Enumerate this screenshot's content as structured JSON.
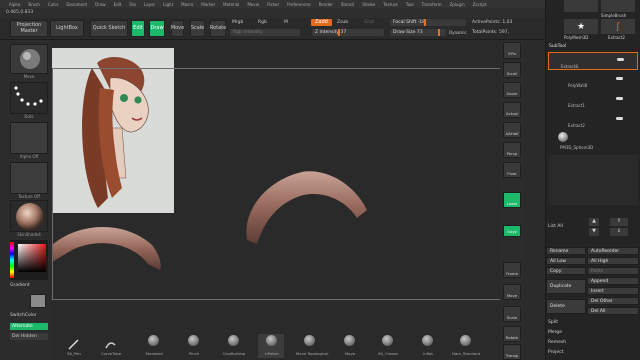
{
  "menu": [
    "Alpha",
    "Brush",
    "Color",
    "Document",
    "Draw",
    "Edit",
    "File",
    "Layer",
    "Light",
    "Macro",
    "Marker",
    "Material",
    "Movie",
    "Picker",
    "Preferences",
    "Render",
    "Stencil",
    "Stroke",
    "Texture",
    "Tool",
    "Transform",
    "Zplugin",
    "Zscript"
  ],
  "info": "0.465,0.833",
  "shelf": {
    "projection_master": "Projection Master",
    "lightbox": "LightBox",
    "quick_sketch": "Quick Sketch",
    "edit": "Edit",
    "draw": "Draw",
    "move": "Move",
    "scale": "Scale",
    "rotate": "Rotate",
    "mrgb": "Mrgb",
    "rgb": "Rgb",
    "m": "M",
    "rgb_intensity": "Rgb Intensity",
    "zadd": "Zadd",
    "zsub": "Zsub",
    "zcut": "Zcut",
    "z_intensity": "Z Intensity 37",
    "focal_shift": "Focal Shift -18",
    "draw_size": "Draw Size 73",
    "dynamic": "Dynamic",
    "active_points": "ActivePoints: 1,03",
    "total_points": "TotalPoints: 597,"
  },
  "left": {
    "brush_label": "Move",
    "stroke_label": "Dots",
    "alpha_label": "Alpha Off",
    "texture_label": "Texture Off",
    "material_label": "SkinShade4",
    "gradient": "Gradient",
    "switchcolor": "SwitchColor",
    "alternate": "Alternate",
    "del_hidden": "Del Hidden"
  },
  "right_icons": [
    "SPix",
    "Scroll",
    "Zoom",
    "Actual",
    "AAHalf",
    "Persp",
    "Floor",
    "Local",
    "Gxyz",
    "Frame",
    "Move",
    "Scale",
    "Rotate",
    "Transp"
  ],
  "panel": {
    "simple_brush": "SimpleBrush",
    "polymesh3d": "PolyMesh3D",
    "extract2": "Extract2",
    "subtool": "SubTool",
    "extract8": "Extract8",
    "polywall": "PolyWall8",
    "extract1": "Extract1",
    "extract2b": "Extract2",
    "sphere": "PM3D_Sphere3D",
    "list_all": "List All",
    "rename": "Rename",
    "autoreorder": "AutoReorder",
    "all_low": "All Low",
    "all_high": "All High",
    "copy": "Copy",
    "paste": "Paste",
    "append": "Append",
    "duplicate": "Duplicate",
    "insert": "Insert",
    "delete": "Delete",
    "del_other": "Del Other",
    "del_all": "Del All",
    "split": "Split",
    "merge": "Merge",
    "remesh": "Remesh",
    "project": "Project"
  },
  "brushes": [
    "SK_Pen",
    "CurveTube",
    "Standard",
    "Pinch",
    "ClayBuildup",
    "hPolish",
    "Move Topological",
    "Move",
    "SK_Crease",
    "Inflat",
    "Dam_Standard"
  ],
  "colors": {
    "accent_green": "#1db96b",
    "accent_orange": "#e26b1e"
  }
}
